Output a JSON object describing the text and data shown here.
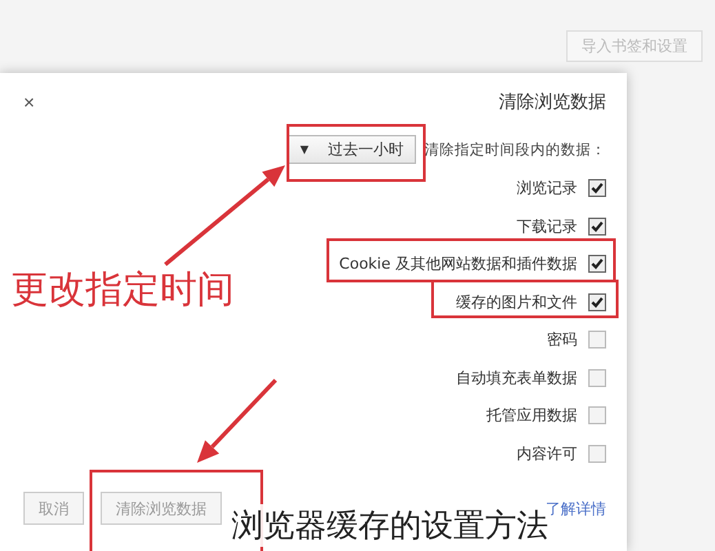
{
  "background": {
    "button": "导入书签和设置"
  },
  "dialog": {
    "title": "清除浏览数据",
    "close": "×",
    "range_label": "清除指定时间段内的数据：",
    "range_value": "过去一小时",
    "range_caret": "▼",
    "options": [
      {
        "label": "浏览记录",
        "checked": true
      },
      {
        "label": "下载记录",
        "checked": true
      },
      {
        "label": "Cookie 及其他网站数据和插件数据",
        "checked": true
      },
      {
        "label": "缓存的图片和文件",
        "checked": true
      },
      {
        "label": "密码",
        "checked": false
      },
      {
        "label": "自动填充表单数据",
        "checked": false
      },
      {
        "label": "托管应用数据",
        "checked": false
      },
      {
        "label": "内容许可",
        "checked": false
      }
    ],
    "link": "了解详情",
    "buttons": [
      "取消",
      "清除浏览数据"
    ]
  },
  "annotation": {
    "callout": "更改指定时间"
  },
  "caption": "浏览器缓存的设置方法"
}
